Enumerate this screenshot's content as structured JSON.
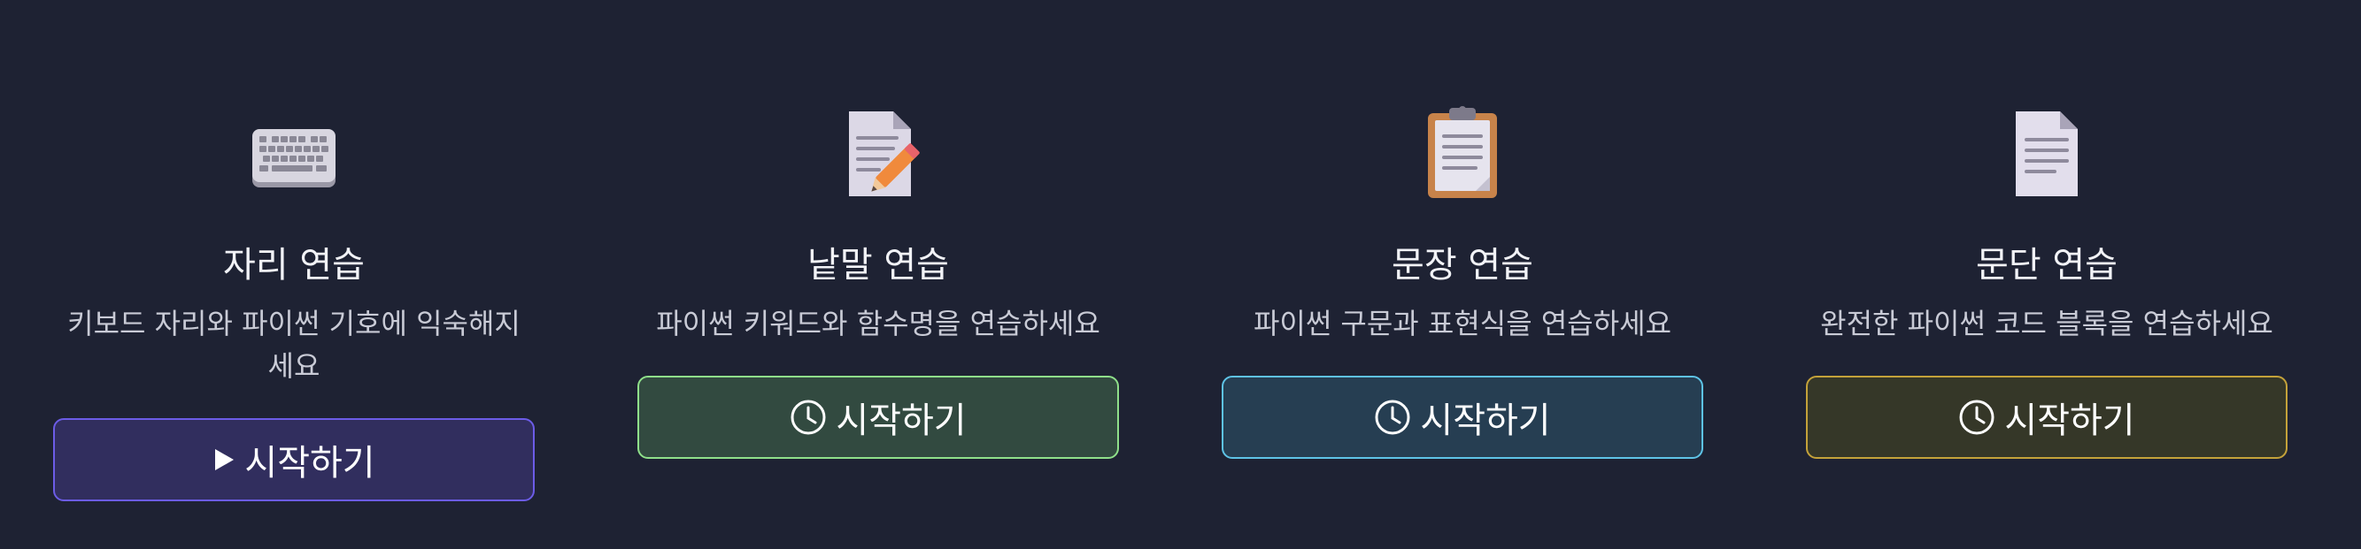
{
  "cards": [
    {
      "icon": "keyboard-icon",
      "title": "자리 연습",
      "description": "키보드 자리와 파이썬 기호에 익숙해지 세요",
      "button_label": "시작하기",
      "button_icon": "play-icon",
      "accent": "#6c5ce7"
    },
    {
      "icon": "memo-icon",
      "title": "낱말 연습",
      "description": "파이썬 키워드와 함수명을 연습하세요",
      "button_label": "시작하기",
      "button_icon": "clock-icon",
      "accent": "#8fe08a"
    },
    {
      "icon": "clipboard-icon",
      "title": "문장 연습",
      "description": "파이썬 구문과 표현식을 연습하세요",
      "button_label": "시작하기",
      "button_icon": "clock-icon",
      "accent": "#5ec3e6"
    },
    {
      "icon": "document-icon",
      "title": "문단 연습",
      "description": "완전한 파이썬 코드 블록을 연습하세요",
      "button_label": "시작하기",
      "button_icon": "clock-icon",
      "accent": "#c4a23a"
    }
  ]
}
